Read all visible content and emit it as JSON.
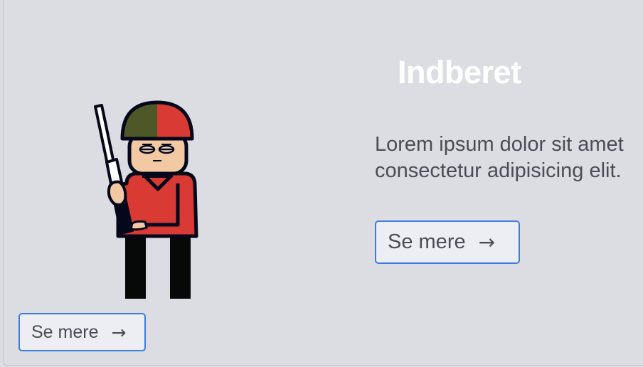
{
  "hero": {
    "title": "Indberet",
    "body": "Lorem ipsum dolor sit amet consectetur adipisicing elit.",
    "illustration_icon": "soldier-illustration"
  },
  "buttons": {
    "primary": {
      "label": "Se mere",
      "icon": "arrow-right-icon",
      "glyph": "→"
    },
    "secondary": {
      "label": "Se mere",
      "icon": "arrow-right-icon",
      "glyph": "→"
    }
  },
  "colors": {
    "background": "#dcdde2",
    "accent": "#3d7bde",
    "text": "#4a4d55",
    "title": "#ffffff",
    "uniform_red": "#d93a34",
    "helmet_green": "#4d5728",
    "outline": "#05081a"
  }
}
